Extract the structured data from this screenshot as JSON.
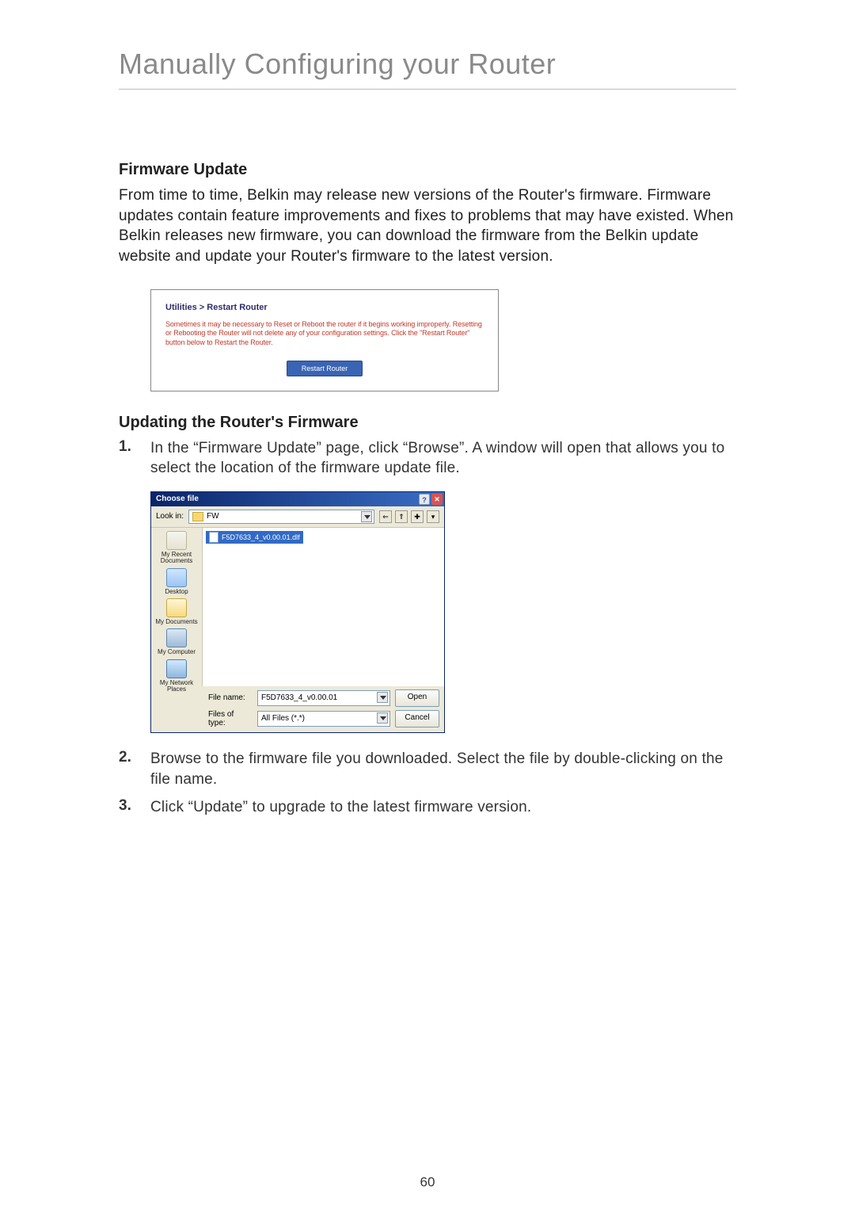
{
  "chapter_title": "Manually Configuring your Router",
  "section1": {
    "heading": "Firmware Update",
    "body": "From time to time, Belkin may release new versions of the Router's firmware. Firmware updates contain feature improvements and fixes to problems that may have existed. When Belkin releases new firmware, you can download the firmware from the Belkin update website and update your Router's firmware to the latest version."
  },
  "router_panel": {
    "title": "Utilities > Restart Router",
    "desc": "Sometimes it may be necessary to Reset or Reboot the router if it begins working improperly. Resetting or Rebooting the Router will not delete any of your configuration settings. Click the \"Restart Router\" button below to Restart the Router.",
    "button_label": "Restart Router"
  },
  "section2": {
    "heading": "Updating the Router's Firmware"
  },
  "steps": [
    {
      "num": "1.",
      "text": "In the “Firmware Update” page, click “Browse”. A window will open that allows you to select the location of the firmware update file."
    },
    {
      "num": "2.",
      "text": "Browse to the firmware file you downloaded. Select the file by double-clicking on the file name."
    },
    {
      "num": "3.",
      "text": "Click “Update” to upgrade to the latest firmware version."
    }
  ],
  "file_dialog": {
    "title": "Choose file",
    "lookin_label": "Look in:",
    "lookin_value": "FW",
    "places": {
      "recent": "My Recent Documents",
      "desktop": "Desktop",
      "documents": "My Documents",
      "computer": "My Computer",
      "network": "My Network Places"
    },
    "selected_file": "F5D7633_4_v0.00.01.dlf",
    "filename_label": "File name:",
    "filename_value": "F5D7633_4_v0.00.01",
    "filetype_label": "Files of type:",
    "filetype_value": "All Files (*.*)",
    "open_label": "Open",
    "cancel_label": "Cancel"
  },
  "page_number": "60"
}
